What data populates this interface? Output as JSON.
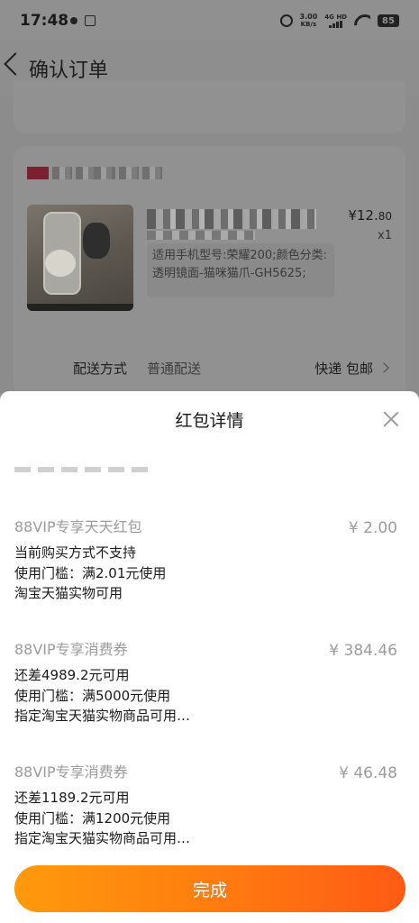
{
  "status_bar": {
    "time": "17:48",
    "net_speed": "3.00",
    "net_speed_unit": "KB/s",
    "network_type": "4G HD",
    "battery": "85"
  },
  "page": {
    "title": "确认订单",
    "product": {
      "price_integer": "¥12.",
      "price_decimal": "80",
      "quantity": "x1",
      "spec": "适用手机型号:荣耀200;颜色分类:透明镜面-猫咪猫爪-GH5625;"
    },
    "delivery": {
      "label": "配送方式",
      "value": "普通配送",
      "right": "快递 包邮"
    }
  },
  "sheet": {
    "title": "红包详情",
    "coupons": [
      {
        "name": "88VIP专享天天红包",
        "amount": "¥ 2.00",
        "status": "当前购买方式不支持",
        "threshold": "使用门槛：满2.01元使用",
        "scope": "淘宝天猫实物可用"
      },
      {
        "name": "88VIP专享消费券",
        "amount": "¥ 384.46",
        "status": "还差4989.2元可用",
        "threshold": "使用门槛：满5000元使用",
        "scope": "指定淘宝天猫实物商品可用…"
      },
      {
        "name": "88VIP专享消费券",
        "amount": "¥ 46.48",
        "status": "还差1189.2元可用",
        "threshold": "使用门槛：满1200元使用",
        "scope": "指定淘宝天猫实物商品可用…"
      }
    ],
    "done_label": "完成"
  },
  "colors": {
    "overlay": "#8c8c8c",
    "button_start": "#ff9a0c",
    "button_end": "#ff5a14",
    "muted_text": "#9b9b9b"
  },
  "icons": [
    "back-icon",
    "close-icon",
    "chevron-right-icon",
    "alarm-icon",
    "wifi-icon",
    "battery-icon",
    "signal-icon"
  ]
}
